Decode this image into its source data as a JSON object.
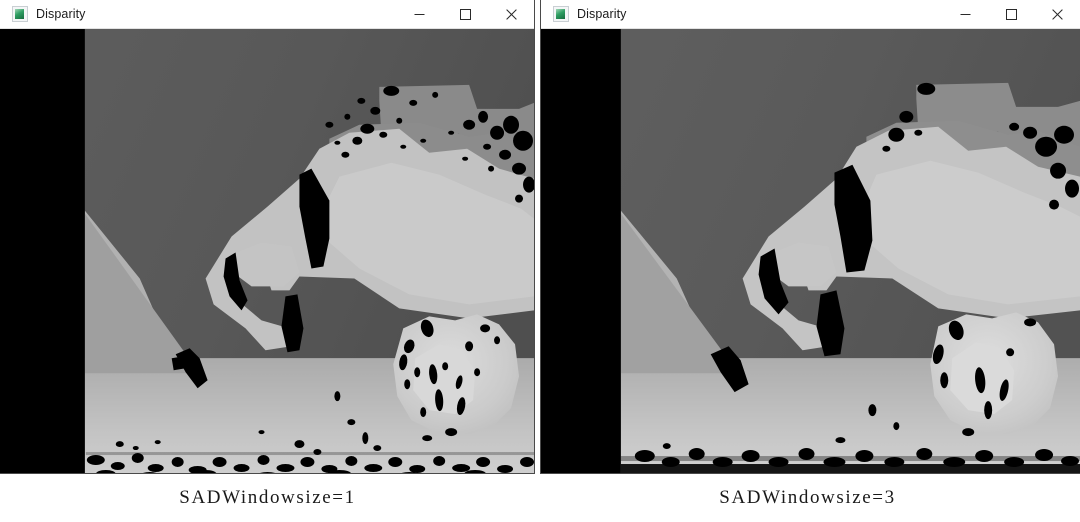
{
  "page": {
    "background": "#ffffff",
    "figure_kind": "stereo-disparity-comparison"
  },
  "windows": [
    {
      "id": "left",
      "title": "Disparity",
      "icon": "image-thumbnail-icon",
      "controls": {
        "minimize_label": "Minimize",
        "maximize_label": "Maximize",
        "close_label": "Close"
      },
      "image": {
        "alt": "Stereo disparity map, SADWindowSize = 1, noisy speckled result",
        "occlusion_band_color": "#000000",
        "background_gray": "#565656",
        "midground_gray": "#8e8e8e",
        "foreground_gray": "#b4b4b4",
        "bright_gray": "#d2d2d2",
        "noise": "high"
      },
      "caption": "SADWindowsize=1"
    },
    {
      "id": "right",
      "title": "Disparity",
      "icon": "image-thumbnail-icon",
      "controls": {
        "minimize_label": "Minimize",
        "maximize_label": "Maximize",
        "close_label": "Close"
      },
      "image": {
        "alt": "Stereo disparity map, SADWindowSize = 3, smoother result",
        "occlusion_band_color": "#000000",
        "background_gray": "#5a5a5a",
        "midground_gray": "#909090",
        "foreground_gray": "#b6b6b6",
        "bright_gray": "#d4d4d4",
        "noise": "low"
      },
      "caption": "SADWindowsize=3"
    }
  ]
}
